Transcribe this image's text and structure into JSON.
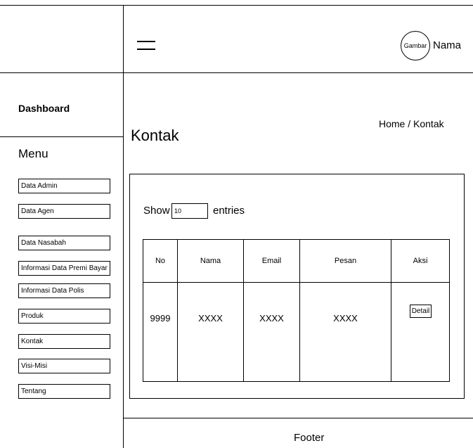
{
  "header": {
    "menu_icon": "hamburger-icon",
    "avatar_text": "Gambar",
    "user_name": "Nama"
  },
  "sidebar": {
    "dashboard_label": "Dashboard",
    "menu_heading": "Menu",
    "items": [
      {
        "label": "Data Admin"
      },
      {
        "label": "Data Agen"
      },
      {
        "label": "Data Nasabah"
      },
      {
        "label": "Informasi Data Premi Bayar"
      },
      {
        "label": "Informasi Data Polis"
      },
      {
        "label": "Produk"
      },
      {
        "label": "Kontak"
      },
      {
        "label": "Visi-Misi"
      },
      {
        "label": "Tentang"
      }
    ]
  },
  "main": {
    "page_title": "Kontak",
    "breadcrumb": "Home / Kontak",
    "show_label": "Show",
    "entries_value": "10",
    "entries_label": "entries",
    "table": {
      "columns": [
        "No",
        "Nama",
        "Email",
        "Pesan",
        "Aksi"
      ],
      "rows": [
        {
          "no": "9999",
          "nama": "XXXX",
          "email": "XXXX",
          "pesan": "XXXX",
          "action_label": "Detail"
        }
      ]
    }
  },
  "footer": {
    "text": "Footer"
  }
}
